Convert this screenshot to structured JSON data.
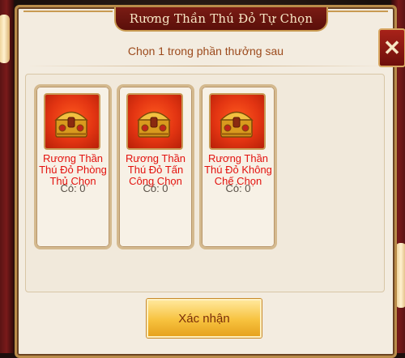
{
  "dialog": {
    "title": "Rương Thần Thú Đỏ Tự Chọn",
    "subtitle": "Chọn 1 trong phần thưởng sau",
    "close_icon": "close-icon"
  },
  "rewards": [
    {
      "name": "Rương Thần Thú Đỏ Phòng Thủ Chọn",
      "count": "Có: 0",
      "icon": "red-treasure-chest-icon"
    },
    {
      "name": "Rương Thần Thú Đỏ Tấn Công Chọn",
      "count": "Có: 0",
      "icon": "red-treasure-chest-icon"
    },
    {
      "name": "Rương Thần Thú Đỏ Không Chế Chọn",
      "count": "Có: 0",
      "icon": "red-treasure-chest-icon"
    }
  ],
  "confirm_button": {
    "label": "Xác nhận"
  },
  "colors": {
    "title_bg": "#7a1c14",
    "reward_text": "#e3120e",
    "button": "#f7c23e"
  }
}
